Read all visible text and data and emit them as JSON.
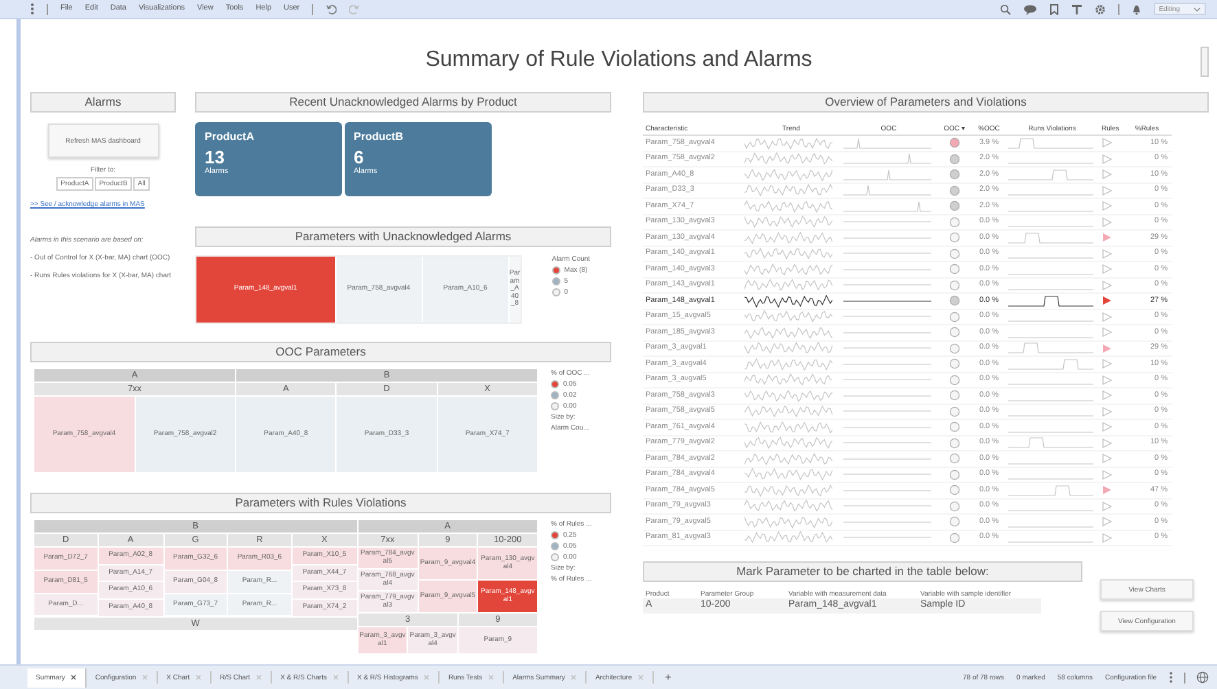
{
  "menu": {
    "items": [
      "File",
      "Edit",
      "Data",
      "Visualizations",
      "View",
      "Tools",
      "Help",
      "User"
    ],
    "mode": "Editing"
  },
  "title": "Summary of Rule Violations and Alarms",
  "alarms_panel": {
    "heading": "Alarms",
    "refresh_button": "Refresh MAS dashboard",
    "filter_label": "Filter to:",
    "filters": [
      "ProductA",
      "ProductB",
      "All"
    ],
    "link": ">> See / acknowledge alarms in MAS",
    "note": "Alarms in this scenario are based on:",
    "bullets": [
      "- Out of Control for X (X-bar, MA) chart (OOC)",
      "- Runs Rules violations for X (X-bar, MA) chart"
    ]
  },
  "recent_alarms": {
    "heading": "Recent Unacknowledged Alarms by Product",
    "tiles": [
      {
        "product": "ProductA",
        "count": "13",
        "unit": "Alarms"
      },
      {
        "product": "ProductB",
        "count": "6",
        "unit": "Alarms"
      }
    ]
  },
  "unack_params": {
    "heading": "Parameters with Unacknowledged Alarms",
    "cells": [
      {
        "label": "Param_148_avgval1",
        "color": "#e2463b"
      },
      {
        "label": "Param_758_avgval4",
        "color": "#eef2f5"
      },
      {
        "label": "Param_A10_6",
        "color": "#eef2f5"
      },
      {
        "label": "Param_A40_8",
        "color": "#f4f6f8"
      }
    ],
    "legend": {
      "title": "Alarm Count",
      "items": [
        {
          "label": "Max (8)",
          "color": "#e2463b"
        },
        {
          "label": "5",
          "color": "#9fb3c3"
        },
        {
          "label": "0",
          "color": "#f2f2f2"
        }
      ]
    }
  },
  "ooc_params": {
    "heading": "OOC Parameters",
    "tree": [
      {
        "label": "A",
        "children": [
          {
            "label": "7xx",
            "children": [
              {
                "label": "Param_758_avgval4",
                "color": "#f8dde0"
              },
              {
                "label": "Param_758_avgval2",
                "color": "#e9eff3"
              }
            ]
          }
        ]
      },
      {
        "label": "B",
        "children": [
          {
            "label": "A",
            "children": [
              {
                "label": "Param_A40_8",
                "color": "#e9eff3"
              }
            ]
          },
          {
            "label": "D",
            "children": [
              {
                "label": "Param_D33_3",
                "color": "#e9eff3"
              }
            ]
          },
          {
            "label": "X",
            "children": [
              {
                "label": "Param_X74_7",
                "color": "#e9eff3"
              }
            ]
          }
        ]
      }
    ],
    "legend": {
      "title": "% of OOC ...",
      "items": [
        {
          "label": "0.05",
          "color": "#e2463b"
        },
        {
          "label": "0.02",
          "color": "#9fb3c3"
        },
        {
          "label": "0.00",
          "color": "#f2f2f2"
        }
      ],
      "size_label": "Size by:",
      "size_value": "Alarm Cou..."
    }
  },
  "rules_params": {
    "heading": "Parameters with Rules Violations",
    "tree": [
      {
        "label": "B",
        "children": [
          {
            "label": "D",
            "children": [
              {
                "label": "Param_D72_7",
                "color": "#f8dde0"
              },
              {
                "label": "Param_D81_5",
                "color": "#f8dde0"
              },
              {
                "label": "Param_D...",
                "color": "#f5eaed"
              }
            ]
          },
          {
            "label": "A",
            "children": [
              {
                "label": "Param_A02_8",
                "color": "#f8dde0"
              },
              {
                "label": "Param_A14_7",
                "color": "#f5eaed"
              },
              {
                "label": "Param_A10_6",
                "color": "#f5eaed"
              },
              {
                "label": "Param_A40_8",
                "color": "#f5eaed"
              }
            ]
          },
          {
            "label": "G",
            "children": [
              {
                "label": "Param_G32_6",
                "color": "#f8dde0"
              },
              {
                "label": "Param_G04_8",
                "color": "#f5eaed"
              },
              {
                "label": "Param_G73_7",
                "color": "#eef2f5"
              }
            ]
          },
          {
            "label": "R",
            "children": [
              {
                "label": "Param_R03_6",
                "color": "#f8dde0"
              },
              {
                "label": "Param_R...",
                "color": "#eef2f5"
              },
              {
                "label": "Param_R...",
                "color": "#eef2f5"
              }
            ]
          },
          {
            "label": "X",
            "children": [
              {
                "label": "Param_X10_5",
                "color": "#f8dde0"
              },
              {
                "label": "Param_X44_7",
                "color": "#f5eaed"
              },
              {
                "label": "Param_X73_8",
                "color": "#f5eaed"
              },
              {
                "label": "Param_X74_2",
                "color": "#f5eaed"
              }
            ]
          },
          {
            "label": "W"
          }
        ]
      },
      {
        "label": "A",
        "children": [
          {
            "label": "7xx",
            "children": [
              {
                "label": "Param_784_avgval5",
                "color": "#f8dde0"
              },
              {
                "label": "Param_768_avgval4",
                "color": "#f5eaed"
              },
              {
                "label": "Param_779_avgval3",
                "color": "#f5eaed"
              }
            ]
          },
          {
            "label": "9",
            "children": [
              {
                "label": "Param_9_avgval4",
                "color": "#f8dde0"
              },
              {
                "label": "Param_9_avgval5",
                "color": "#f8dde0"
              }
            ]
          },
          {
            "label": "10-200",
            "children": [
              {
                "label": "Param_130_avgval4",
                "color": "#f8dde0"
              },
              {
                "label": "Param_148_avgval1",
                "color": "#e2463b"
              }
            ]
          },
          {
            "label": "3",
            "children": [
              {
                "label": "Param_3_avgval1",
                "color": "#f8dde0"
              },
              {
                "label": "Param_3_avgval4",
                "color": "#f5eaed"
              }
            ]
          },
          {
            "label": "9",
            "children": [
              {
                "label": "Param_9",
                "color": "#f5eaed"
              }
            ]
          }
        ]
      }
    ],
    "legend": {
      "title": "% of Rules ...",
      "items": [
        {
          "label": "0.25",
          "color": "#e2463b"
        },
        {
          "label": "0.05",
          "color": "#9fb3c3"
        },
        {
          "label": "0.00",
          "color": "#f2f2f2"
        }
      ],
      "size_label": "Size by:",
      "size_value": "% of Rules ..."
    }
  },
  "overview": {
    "heading": "Overview of Parameters and Violations",
    "columns": [
      "Characteristic",
      "Trend",
      "OOC",
      "OOC ▾",
      "%OOC",
      "Runs Violations",
      "Rules",
      "%Rules"
    ],
    "rows": [
      {
        "name": "Param_758_avgval4",
        "ooc_pct": "3.9 %",
        "rules_pct": "10 %",
        "color": "#f2a9b3",
        "rules_flagged": false,
        "ooc_spike": true,
        "violations": true,
        "selected": false
      },
      {
        "name": "Param_758_avgval2",
        "ooc_pct": "2.0 %",
        "rules_pct": "0 %",
        "color": "#cfcfcf",
        "rules_flagged": false,
        "ooc_spike": true,
        "violations": false,
        "selected": false
      },
      {
        "name": "Param_A40_8",
        "ooc_pct": "2.0 %",
        "rules_pct": "10 %",
        "color": "#cfcfcf",
        "rules_flagged": false,
        "ooc_spike": true,
        "violations": true,
        "selected": false
      },
      {
        "name": "Param_D33_3",
        "ooc_pct": "2.0 %",
        "rules_pct": "0 %",
        "color": "#cfcfcf",
        "rules_flagged": false,
        "ooc_spike": true,
        "violations": false,
        "selected": false
      },
      {
        "name": "Param_X74_7",
        "ooc_pct": "2.0 %",
        "rules_pct": "0 %",
        "color": "#cfcfcf",
        "rules_flagged": false,
        "ooc_spike": true,
        "violations": false,
        "selected": false
      },
      {
        "name": "Param_130_avgval3",
        "ooc_pct": "0.0 %",
        "rules_pct": "0 %",
        "color": "#f5f5f5",
        "rules_flagged": false,
        "ooc_spike": false,
        "violations": false,
        "selected": false
      },
      {
        "name": "Param_130_avgval4",
        "ooc_pct": "0.0 %",
        "rules_pct": "29 %",
        "color": "#f5f5f5",
        "rules_flagged": true,
        "ooc_spike": false,
        "violations": true,
        "selected": false
      },
      {
        "name": "Param_140_avgval1",
        "ooc_pct": "0.0 %",
        "rules_pct": "0 %",
        "color": "#f5f5f5",
        "rules_flagged": false,
        "ooc_spike": false,
        "violations": false,
        "selected": false
      },
      {
        "name": "Param_140_avgval3",
        "ooc_pct": "0.0 %",
        "rules_pct": "0 %",
        "color": "#f5f5f5",
        "rules_flagged": false,
        "ooc_spike": false,
        "violations": false,
        "selected": false
      },
      {
        "name": "Param_143_avgval1",
        "ooc_pct": "0.0 %",
        "rules_pct": "0 %",
        "color": "#f5f5f5",
        "rules_flagged": false,
        "ooc_spike": false,
        "violations": false,
        "selected": false
      },
      {
        "name": "Param_148_avgval1",
        "ooc_pct": "0.0 %",
        "rules_pct": "27 %",
        "color": "#cfcfcf",
        "rules_flagged": true,
        "ooc_spike": false,
        "violations": true,
        "selected": true
      },
      {
        "name": "Param_15_avgval5",
        "ooc_pct": "0.0 %",
        "rules_pct": "0 %",
        "color": "#f5f5f5",
        "rules_flagged": false,
        "ooc_spike": false,
        "violations": false,
        "selected": false
      },
      {
        "name": "Param_185_avgval3",
        "ooc_pct": "0.0 %",
        "rules_pct": "0 %",
        "color": "#f5f5f5",
        "rules_flagged": false,
        "ooc_spike": false,
        "violations": false,
        "selected": false
      },
      {
        "name": "Param_3_avgval1",
        "ooc_pct": "0.0 %",
        "rules_pct": "29 %",
        "color": "#f5f5f5",
        "rules_flagged": true,
        "ooc_spike": false,
        "violations": true,
        "selected": false
      },
      {
        "name": "Param_3_avgval4",
        "ooc_pct": "0.0 %",
        "rules_pct": "10 %",
        "color": "#f5f5f5",
        "rules_flagged": false,
        "ooc_spike": false,
        "violations": true,
        "selected": false
      },
      {
        "name": "Param_3_avgval5",
        "ooc_pct": "0.0 %",
        "rules_pct": "0 %",
        "color": "#f5f5f5",
        "rules_flagged": false,
        "ooc_spike": false,
        "violations": false,
        "selected": false
      },
      {
        "name": "Param_758_avgval3",
        "ooc_pct": "0.0 %",
        "rules_pct": "0 %",
        "color": "#f5f5f5",
        "rules_flagged": false,
        "ooc_spike": false,
        "violations": false,
        "selected": false
      },
      {
        "name": "Param_758_avgval5",
        "ooc_pct": "0.0 %",
        "rules_pct": "0 %",
        "color": "#f5f5f5",
        "rules_flagged": false,
        "ooc_spike": false,
        "violations": false,
        "selected": false
      },
      {
        "name": "Param_761_avgval4",
        "ooc_pct": "0.0 %",
        "rules_pct": "0 %",
        "color": "#f5f5f5",
        "rules_flagged": false,
        "ooc_spike": false,
        "violations": false,
        "selected": false
      },
      {
        "name": "Param_779_avgval2",
        "ooc_pct": "0.0 %",
        "rules_pct": "10 %",
        "color": "#f5f5f5",
        "rules_flagged": false,
        "ooc_spike": false,
        "violations": true,
        "selected": false
      },
      {
        "name": "Param_784_avgval2",
        "ooc_pct": "0.0 %",
        "rules_pct": "0 %",
        "color": "#f5f5f5",
        "rules_flagged": false,
        "ooc_spike": false,
        "violations": false,
        "selected": false
      },
      {
        "name": "Param_784_avgval4",
        "ooc_pct": "0.0 %",
        "rules_pct": "0 %",
        "color": "#f5f5f5",
        "rules_flagged": false,
        "ooc_spike": false,
        "violations": false,
        "selected": false
      },
      {
        "name": "Param_784_avgval5",
        "ooc_pct": "0.0 %",
        "rules_pct": "47 %",
        "color": "#f5f5f5",
        "rules_flagged": true,
        "ooc_spike": false,
        "violations": true,
        "selected": false
      },
      {
        "name": "Param_79_avgval3",
        "ooc_pct": "0.0 %",
        "rules_pct": "0 %",
        "color": "#f5f5f5",
        "rules_flagged": false,
        "ooc_spike": false,
        "violations": false,
        "selected": false
      },
      {
        "name": "Param_79_avgval5",
        "ooc_pct": "0.0 %",
        "rules_pct": "0 %",
        "color": "#f5f5f5",
        "rules_flagged": false,
        "ooc_spike": false,
        "violations": false,
        "selected": false
      },
      {
        "name": "Param_81_avgval3",
        "ooc_pct": "0.0 %",
        "rules_pct": "0 %",
        "color": "#f5f5f5",
        "rules_flagged": false,
        "ooc_spike": false,
        "violations": false,
        "selected": false
      }
    ]
  },
  "mark_panel": {
    "heading": "Mark Parameter to be charted in the table below:",
    "columns": [
      "Product",
      "Parameter Group",
      "Variable with measurement data",
      "Variable with sample identifier"
    ],
    "row": [
      "A",
      "10-200",
      "Param_148_avgval1",
      "Sample ID"
    ]
  },
  "buttons": [
    "View Charts",
    "View Configuration"
  ],
  "tabs": [
    {
      "label": "Summary",
      "selected": true
    },
    {
      "label": "Configuration",
      "selected": false
    },
    {
      "label": "X Chart",
      "selected": false
    },
    {
      "label": "R/S Chart",
      "selected": false
    },
    {
      "label": "X & R/S Charts",
      "selected": false
    },
    {
      "label": "X & R/S Histograms",
      "selected": false
    },
    {
      "label": "Runs Tests",
      "selected": false
    },
    {
      "label": "Alarms Summary",
      "selected": false
    },
    {
      "label": "Architecture",
      "selected": false
    }
  ],
  "add_tab": "+",
  "status": [
    "78 of 78 rows",
    "0 marked",
    "58 columns",
    "Configuration file"
  ]
}
